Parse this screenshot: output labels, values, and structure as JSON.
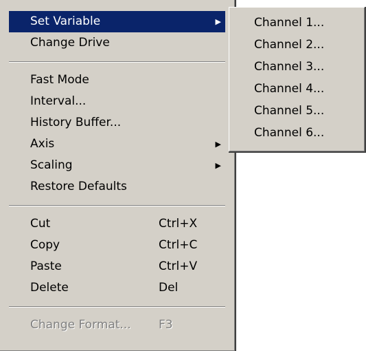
{
  "main_menu": {
    "set_variable": "Set Variable",
    "change_drive": "Change Drive",
    "fast_mode": "Fast Mode",
    "interval": "Interval...",
    "history_buffer": "History Buffer...",
    "axis": "Axis",
    "scaling": "Scaling",
    "restore_defaults": "Restore Defaults",
    "cut": {
      "label": "Cut",
      "shortcut": "Ctrl+X"
    },
    "copy": {
      "label": "Copy",
      "shortcut": "Ctrl+C"
    },
    "paste": {
      "label": "Paste",
      "shortcut": "Ctrl+V"
    },
    "delete": {
      "label": "Delete",
      "shortcut": "Del"
    },
    "change_format": {
      "label": "Change Format...",
      "shortcut": "F3"
    },
    "submenu_arrow": "▶"
  },
  "submenu": {
    "items": [
      "Channel 1...",
      "Channel 2...",
      "Channel 3...",
      "Channel 4...",
      "Channel 5...",
      "Channel 6..."
    ]
  },
  "colors": {
    "menu_background": "#d4d0c8",
    "highlight_background": "#0a246a",
    "highlight_text": "#ffffff",
    "disabled_text": "#808080"
  },
  "icons": {
    "submenu_indicator": "triangle-right-icon"
  }
}
